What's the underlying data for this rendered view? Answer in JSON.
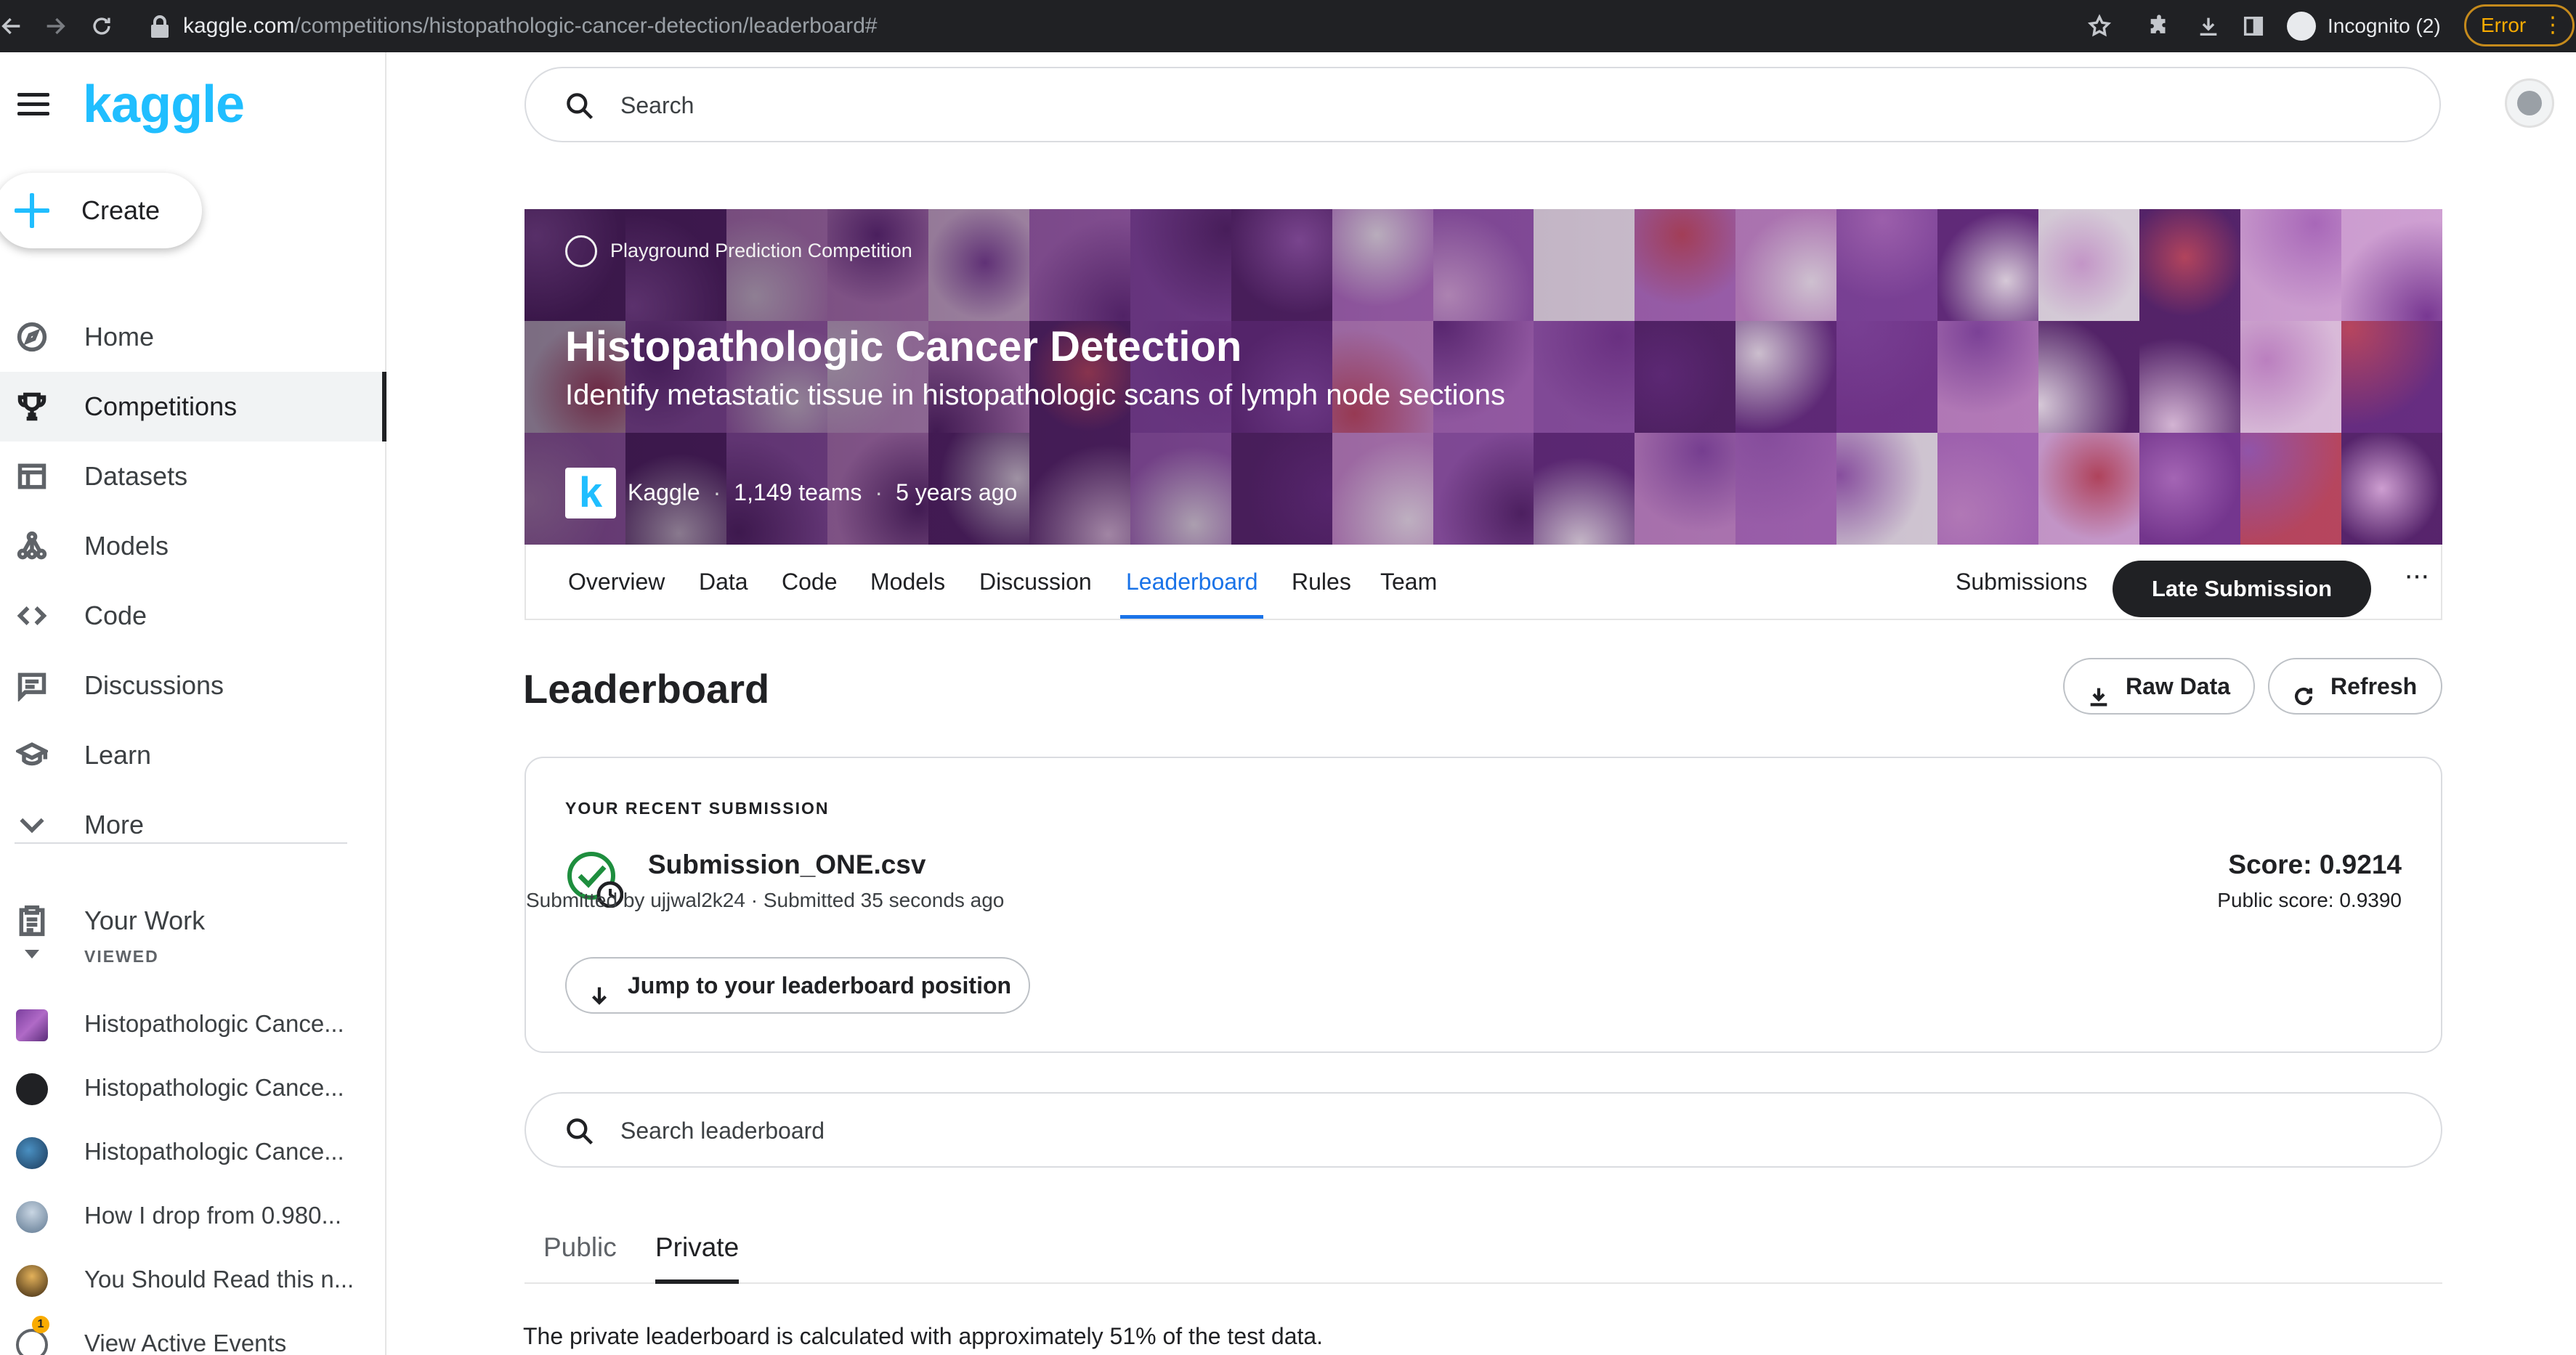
{
  "browser": {
    "url_host": "kaggle.com",
    "url_path": "/competitions/histopathologic-cancer-detection/leaderboard#",
    "profile_label": "Incognito (2)",
    "error_label": "Error"
  },
  "sidebar": {
    "logo": "kaggle",
    "create_label": "Create",
    "items": [
      {
        "label": "Home",
        "icon": "compass-icon"
      },
      {
        "label": "Competitions",
        "icon": "trophy-icon",
        "active": true
      },
      {
        "label": "Datasets",
        "icon": "table-icon"
      },
      {
        "label": "Models",
        "icon": "models-icon"
      },
      {
        "label": "Code",
        "icon": "code-icon"
      },
      {
        "label": "Discussions",
        "icon": "discussion-icon"
      },
      {
        "label": "Learn",
        "icon": "school-icon"
      },
      {
        "label": "More",
        "icon": "chevron-down-icon"
      }
    ],
    "your_work_label": "Your Work",
    "viewed_header": "VIEWED",
    "viewed_items": [
      {
        "label": "Histopathologic Cance..."
      },
      {
        "label": "Histopathologic Cance..."
      },
      {
        "label": "Histopathologic Cance..."
      },
      {
        "label": "How I drop from 0.980..."
      },
      {
        "label": "You Should Read this n..."
      },
      {
        "label": "View Active Events"
      }
    ],
    "events_badge": "1"
  },
  "search": {
    "placeholder": "Search"
  },
  "competition": {
    "type_label": "Playground Prediction Competition",
    "title": "Histopathologic Cancer Detection",
    "subtitle": "Identify metastatic tissue in histopathologic scans of lymph node sections",
    "host": "Kaggle",
    "host_initial": "k",
    "teams": "1,149 teams",
    "age": "5 years ago"
  },
  "tabs": {
    "items": [
      "Overview",
      "Data",
      "Code",
      "Models",
      "Discussion",
      "Leaderboard",
      "Rules",
      "Team"
    ],
    "active": "Leaderboard",
    "submissions_label": "Submissions",
    "late_submission_label": "Late Submission",
    "more_label": "···"
  },
  "leaderboard": {
    "heading": "Leaderboard",
    "raw_data_label": "Raw Data",
    "refresh_label": "Refresh",
    "recent_label": "YOUR RECENT SUBMISSION",
    "submission_file": "Submission_ONE.csv",
    "submission_meta": "Submitted by ujjwal2k24 · Submitted 35 seconds ago",
    "score": "Score: 0.9214",
    "public_score": "Public score: 0.9390",
    "jump_label": "Jump to your leaderboard position",
    "search_placeholder": "Search leaderboard",
    "views": [
      "Public",
      "Private"
    ],
    "active_view": "Private",
    "private_note": "The private leaderboard is calculated with approximately 51% of the test data."
  },
  "colors": {
    "brand": "#20beff",
    "active_tab": "#1a73e8",
    "success": "#1e8e3e"
  }
}
